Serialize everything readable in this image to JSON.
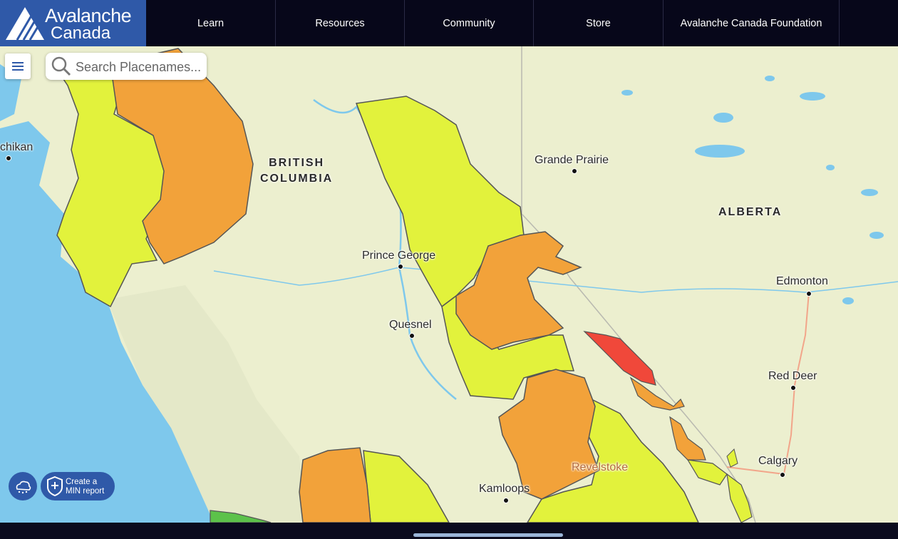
{
  "brand": {
    "line1": "Avalanche",
    "line2": "Canada"
  },
  "nav": [
    {
      "label": "Learn"
    },
    {
      "label": "Resources"
    },
    {
      "label": "Community"
    },
    {
      "label": "Store"
    },
    {
      "label": "Avalanche Canada Foundation"
    }
  ],
  "search": {
    "placeholder": "Search Placenames..."
  },
  "map": {
    "provinces": {
      "bc_line1": "BRITISH",
      "bc_line2": "COLUMBIA",
      "alberta": "ALBERTA"
    },
    "places": {
      "chikan": "chikan",
      "grande_prairie": "Grande Prairie",
      "prince_george": "Prince George",
      "quesnel": "Quesnel",
      "edmonton": "Edmonton",
      "red_deer": "Red Deer",
      "calgary": "Calgary",
      "kamloops": "Kamloops",
      "revelstoke": "Revelstoke"
    },
    "danger_colors": {
      "moderate": "#e2f23c",
      "considerable": "#f2a23a",
      "high": "#f0483a",
      "low": "#5cc24a"
    }
  },
  "buttons": {
    "min_line1": "Create a",
    "min_line2": "MIN report"
  },
  "icons": [
    "logo-mountain-icon",
    "menu-icon",
    "search-icon",
    "weather-icon",
    "min-report-icon"
  ]
}
